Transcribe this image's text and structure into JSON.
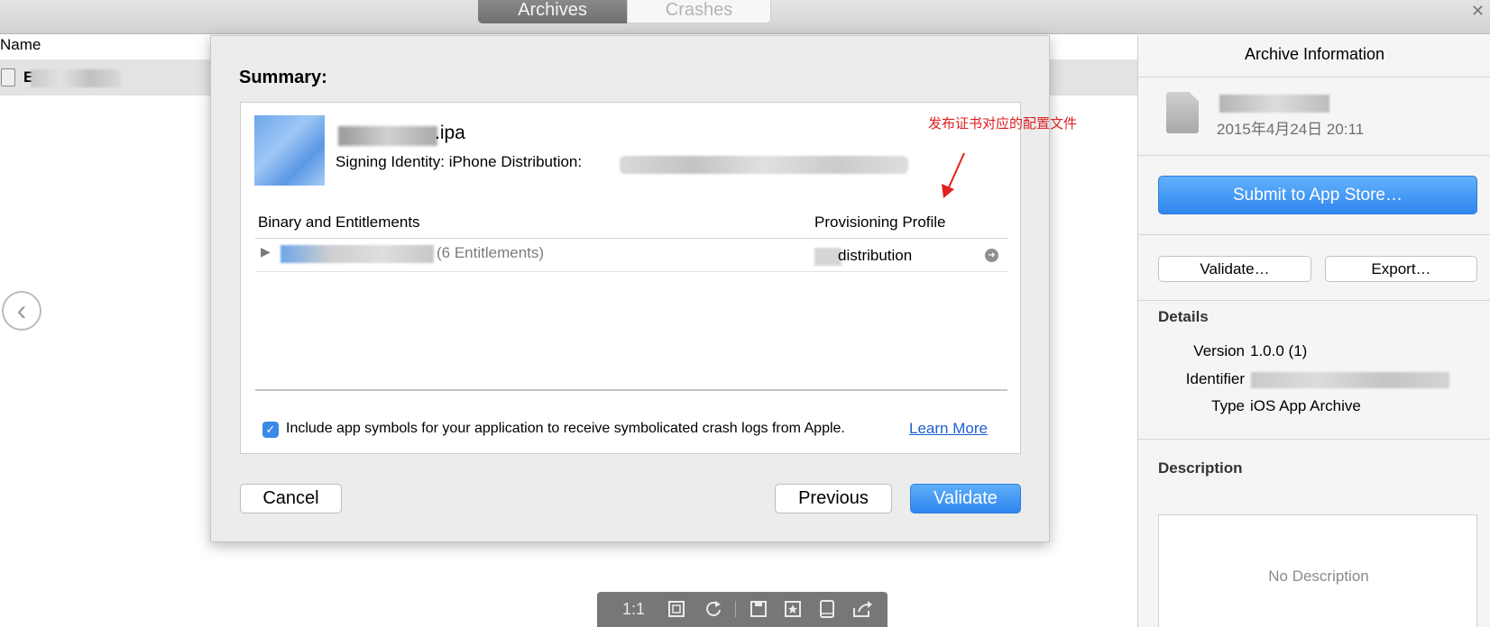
{
  "toolbar": {
    "tabs": [
      "Archives",
      "Crashes"
    ],
    "active_tab": "Archives",
    "close_glyph": "✕"
  },
  "list": {
    "column_header": "Name",
    "row_initial": "E"
  },
  "nav": {
    "previous_glyph": "‹"
  },
  "modal": {
    "title": "Summary:",
    "ipa_suffix": ".ipa",
    "signing_identity": "Signing Identity: iPhone Distribution:",
    "col_binary": "Binary and Entitlements",
    "col_profile": "Provisioning Profile",
    "entitlements": "(6 Entitlements)",
    "profile_value": "distribution",
    "include_symbols": "Include app symbols for your application to receive symbolicated crash logs from Apple.",
    "learn_more": "Learn More",
    "include_checked": true,
    "buttons": {
      "cancel": "Cancel",
      "previous": "Previous",
      "validate": "Validate"
    }
  },
  "annotation": {
    "text": "发布证书对应的配置文件",
    "color": "#e02020"
  },
  "archive_info": {
    "title": "Archive Information",
    "date": "2015年4月24日 20:11",
    "submit": "Submit to App Store…",
    "validate": "Validate…",
    "export": "Export…",
    "details_heading": "Details",
    "version_label": "Version",
    "version_value": "1.0.0 (1)",
    "identifier_label": "Identifier",
    "type_label": "Type",
    "type_value": "iOS App Archive",
    "description_heading": "Description",
    "description_placeholder": "No Description"
  },
  "viewer": {
    "zoom": "1:1",
    "icons": [
      "fit-screen-icon",
      "rotate-icon",
      "save-icon",
      "favorite-icon",
      "device-icon",
      "share-icon"
    ]
  },
  "colors": {
    "accent": "#2f86ef",
    "link": "#1d5fcf"
  }
}
